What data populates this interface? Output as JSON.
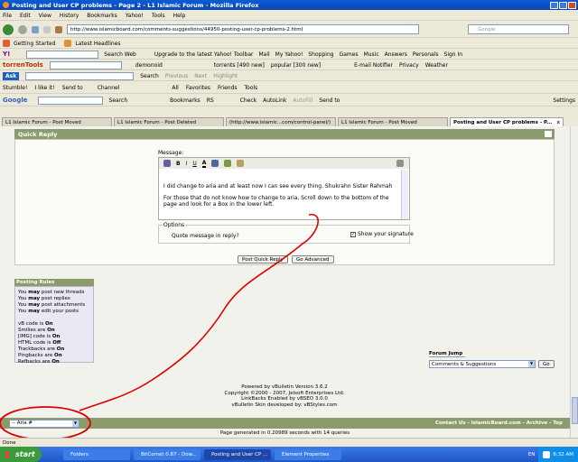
{
  "window": {
    "title": "Posting and User CP problems - Page 2 - L1 Islamic Forum - Mozilla Firefox"
  },
  "menu": [
    "File",
    "Edit",
    "View",
    "History",
    "Bookmarks",
    "Yahoo!",
    "Tools",
    "Help"
  ],
  "nav": {
    "url": "http://www.islamicboard.com/comments-suggestions/44950-posting-user-cp-problems-2.html",
    "search_placeholder": "Google"
  },
  "bookmarks": [
    "Getting Started",
    "Latest Headlines"
  ],
  "yahoo_bar": {
    "search": "Search Web",
    "upgrade": "Upgrade to the latest Yahoo! Toolbar",
    "items": [
      "Mail",
      "My Yahoo!",
      "Shopping",
      "Games",
      "Music",
      "Answers",
      "Personals",
      "Sign In"
    ]
  },
  "torrent_bar": {
    "logo": "torrenTools",
    "user": "demonoid",
    "torrents": "torrents [490 new]",
    "popular": "popular [300 new]",
    "email": "E-mail Notifier",
    "privacy": "Privacy",
    "weather": "Weather"
  },
  "ask_bar": {
    "logo": "Ask",
    "search": "Search",
    "previous": "Previous",
    "next": "Next",
    "highlight": "Highlight"
  },
  "stumble_bar": {
    "stumble": "Stumble!",
    "like": "I like it!",
    "send": "Send to",
    "channel": "Channel",
    "all": "All",
    "favorites": "Favorites",
    "friends": "Friends",
    "tools": "Tools"
  },
  "google_bar": {
    "logo": "Google",
    "search": "Search",
    "bookmarks": "Bookmarks",
    "rs": "RS",
    "check": "Check",
    "autolink": "AutoLink",
    "autofill": "AutoFill",
    "sendto": "Send to",
    "settings": "Settings"
  },
  "tabs": [
    "L1 Islamic Forum - Post Moved",
    "L1 Islamic Forum - Post Deleted",
    "(http://www.islamic...com/control-panel/)",
    "L1 Islamic Forum - Post Moved",
    "Posting and User CP problems - P..."
  ],
  "quick_reply": {
    "title": "Quick Reply",
    "message_label": "Message:",
    "line1": "I did change to aria and at least now I can see every thing. Shukrahn  Sister Rahmah",
    "line2": "For those that do not know how to change to aria, Scroll down to the bottom of the page and look for a Box in the lower left.",
    "options_label": "Options",
    "quote": "Quote message in reply?",
    "signature": "Show your signature",
    "post_btn": "Post Quick Reply",
    "advanced_btn": "Go Advanced"
  },
  "rules": {
    "title": "Posting Rules",
    "lines": [
      [
        {
          "t": "You "
        },
        {
          "b": "may"
        },
        {
          "t": " post new threads"
        }
      ],
      [
        {
          "t": "You "
        },
        {
          "b": "may"
        },
        {
          "t": " post replies"
        }
      ],
      [
        {
          "t": "You "
        },
        {
          "b": "may"
        },
        {
          "t": " post attachments"
        }
      ],
      [
        {
          "t": "You "
        },
        {
          "b": "may"
        },
        {
          "t": " edit your posts"
        }
      ],
      [],
      [
        {
          "t": "vB code is "
        },
        {
          "b": "On"
        }
      ],
      [
        {
          "t": "Smilies are "
        },
        {
          "b": "On"
        }
      ],
      [
        {
          "t": "[IMG] code is "
        },
        {
          "b": "On"
        }
      ],
      [
        {
          "t": "HTML code is "
        },
        {
          "b": "Off"
        }
      ],
      [
        {
          "t": "Trackbacks are "
        },
        {
          "b": "On"
        }
      ],
      [
        {
          "t": "Pingbacks are "
        },
        {
          "b": "On"
        }
      ],
      [
        {
          "t": "Refbacks are "
        },
        {
          "b": "On"
        }
      ]
    ]
  },
  "forum_jump": {
    "label": "Forum Jump",
    "selected": "Comments & Suggestions",
    "go": "Go"
  },
  "footer": {
    "line1": "Powered by vBulletin Version 3.6.2",
    "line2": "Copyright ©2000 - 2007, Jelsoft Enterprises Ltd.",
    "line3": "LinkBacks Enabled by vBSEO 3.0.0",
    "line4": "vBulletin Skin developed by: vBStyles.com",
    "links": "Contact Us - IslamicBoard.com - Archive - Top",
    "style_select": "-- Aria #",
    "generated": "Page generated in 0.20989 seconds with 14 queries"
  },
  "status": "Done",
  "taskbar": {
    "start": "start",
    "items": [
      "Folders",
      "BitComet 0.87 - Dow...",
      "Posting and User CP ...",
      "Element Properties"
    ],
    "lang": "EN",
    "time": "6:32 AM"
  },
  "colors": {
    "forum_green": "#8b9b6c",
    "annotation": "#e00000",
    "taskbar": "#245edb",
    "start": "#3c9a3c"
  }
}
